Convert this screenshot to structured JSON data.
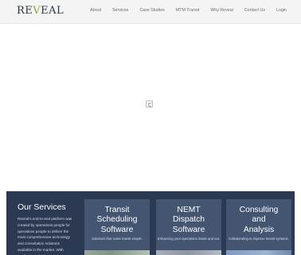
{
  "brand": {
    "logo_pre": "RE",
    "logo_accent": "V",
    "logo_post": "EAL"
  },
  "nav": {
    "items": [
      {
        "label": "About"
      },
      {
        "label": "Services"
      },
      {
        "label": "Case Studies"
      },
      {
        "label": "MTM Transit"
      },
      {
        "label": "Why Reveal"
      },
      {
        "label": "Contact Us"
      },
      {
        "label": "Login"
      }
    ]
  },
  "services": {
    "title": "Our Services",
    "description": "Reveal’s end-to-end platform was created by operations people for operations people to deliver the most comprehensive technology and consultation solutions available in the market. With applications that improve",
    "cards": [
      {
        "title": "Transit\nScheduling\nSoftware",
        "subtitle": "Solutions that make transit simple."
      },
      {
        "title": "NEMT\nDispatch\nSoftware",
        "subtitle": "Enhancing your operations inside and out."
      },
      {
        "title": "Consulting\nand\nAnalysis",
        "subtitle": "Collaborating to improve transit systems."
      }
    ]
  },
  "colors": {
    "band": "#2b3a52",
    "card": "#435571",
    "logo": "#2a3448",
    "logo_accent": "#7ab03a"
  }
}
